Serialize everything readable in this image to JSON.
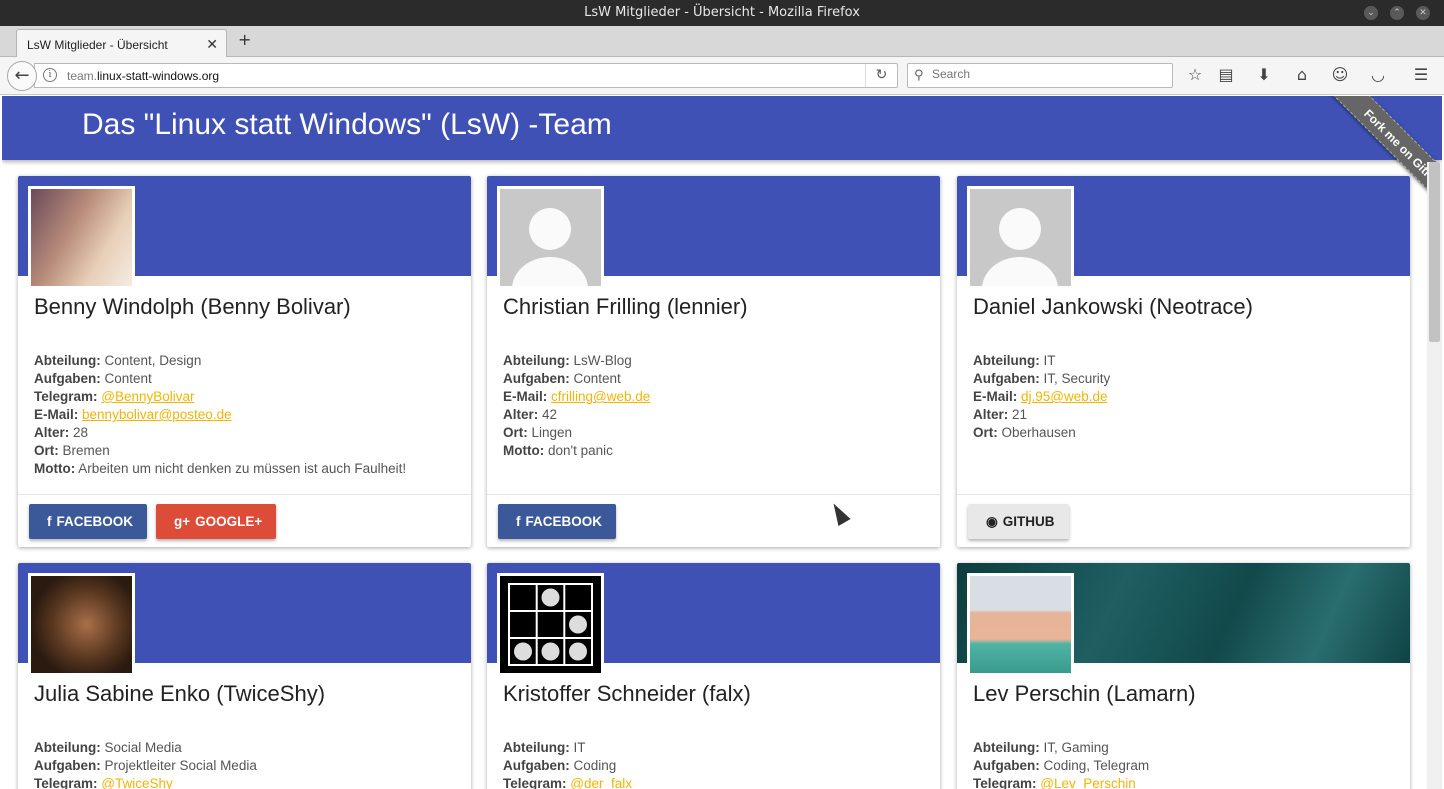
{
  "window": {
    "title": "LsW Mitglieder - Übersicht - Mozilla Firefox"
  },
  "tab": {
    "title": "LsW Mitglieder - Übersicht",
    "close": "✕",
    "new": "+"
  },
  "nav": {
    "url_sub": "team.",
    "url_main": "linux-statt-windows.org",
    "search_placeholder": "Search"
  },
  "page": {
    "title": "Das \"Linux statt Windows\" (LsW) -Team",
    "ribbon": "Fork me on GitHub"
  },
  "labels": {
    "abteilung": "Abteilung:",
    "aufgaben": "Aufgaben:",
    "telegram": "Telegram:",
    "email": "E-Mail:",
    "alter": "Alter:",
    "ort": "Ort:",
    "motto": "Motto:"
  },
  "buttons": {
    "facebook": "FACEBOOK",
    "google": "GOOGLE+",
    "github": "GITHUB"
  },
  "members": [
    {
      "name": "Benny Windolph (Benny Bolivar)",
      "abteilung": "Content, Design",
      "aufgaben": "Content",
      "telegram": "@BennyBolivar",
      "email": "bennybolivar@posteo.de",
      "alter": "28",
      "ort": "Bremen",
      "motto": "Arbeiten um nicht denken zu müssen ist auch Faulheit!"
    },
    {
      "name": "Christian Frilling (lennier)",
      "abteilung": "LsW-Blog",
      "aufgaben": "Content",
      "email": "cfrilling@web.de",
      "alter": "42",
      "ort": "Lingen",
      "motto": "don't panic"
    },
    {
      "name": "Daniel Jankowski (Neotrace)",
      "abteilung": "IT",
      "aufgaben": "IT, Security",
      "email": "dj.95@web.de",
      "alter": "21",
      "ort": "Oberhausen"
    },
    {
      "name": "Julia Sabine Enko (TwiceShy)",
      "abteilung": "Social Media",
      "aufgaben": "Projektleiter Social Media",
      "telegram": "@TwiceShy"
    },
    {
      "name": "Kristoffer Schneider (falx)",
      "abteilung": "IT",
      "aufgaben": "Coding",
      "telegram": "@der_falx"
    },
    {
      "name": "Lev Perschin (Lamarn)",
      "abteilung": "IT, Gaming",
      "aufgaben": "Coding, Telegram",
      "telegram": "@Lev_Perschin"
    }
  ],
  "colors": {
    "header": "#3f51b5",
    "link": "#f4b400",
    "facebook": "#3b5998",
    "google": "#dd4b39"
  }
}
